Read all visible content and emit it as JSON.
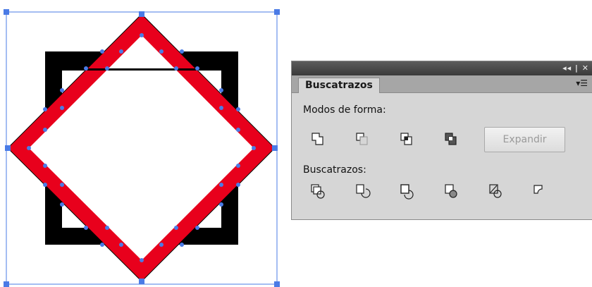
{
  "panel": {
    "title_controls": "◂◂ | ✕",
    "tab_label": "Buscatrazos",
    "menu_icon": "panel-menu-icon",
    "shape_modes": {
      "label": "Modos de forma:",
      "buttons": [
        {
          "name": "unite-icon"
        },
        {
          "name": "minus-front-icon"
        },
        {
          "name": "intersect-icon"
        },
        {
          "name": "exclude-icon"
        }
      ],
      "expand_label": "Expandir"
    },
    "pathfinders": {
      "label": "Buscatrazos:",
      "buttons": [
        {
          "name": "divide-icon"
        },
        {
          "name": "trim-icon"
        },
        {
          "name": "merge-icon"
        },
        {
          "name": "crop-icon"
        },
        {
          "name": "outline-icon"
        },
        {
          "name": "minus-back-icon"
        }
      ]
    }
  },
  "colors": {
    "selection": "#4a7be6",
    "square_stroke": "#000000",
    "diamond_stroke": "#e8001c",
    "panel_bg": "#d6d6d6"
  }
}
